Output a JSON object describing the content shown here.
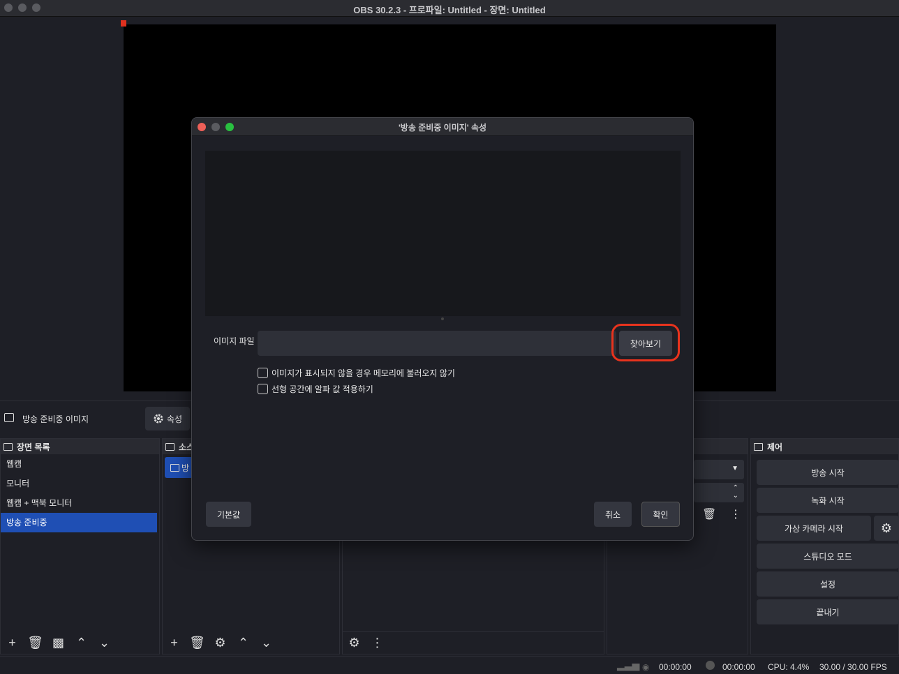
{
  "window": {
    "title": "OBS 30.2.3 - 프로파일: Untitled - 장면: Untitled"
  },
  "source_bar": {
    "source_name": "방송 준비중 이미지",
    "properties_label": "속성"
  },
  "scenes": {
    "header": "장면 목록",
    "items": [
      "웹캠",
      "모니터",
      "웹캠 + 맥북 모니터",
      "방송 준비중"
    ],
    "selected_index": 3
  },
  "sources": {
    "header": "소스",
    "first_item": "방"
  },
  "controls": {
    "header": "제어",
    "start_streaming": "방송 시작",
    "start_recording": "녹화 시작",
    "virtual_camera": "가상 카메라 시작",
    "studio_mode": "스튜디오 모드",
    "settings": "설정",
    "exit": "끝내기"
  },
  "status": {
    "stream_time": "00:00:00",
    "record_time": "00:00:00",
    "cpu": "CPU: 4.4%",
    "fps": "30.00 / 30.00 FPS"
  },
  "dialog": {
    "title": "'방송 준비중 이미지' 속성",
    "image_file_label": "이미지 파일",
    "image_file_value": "",
    "browse_label": "찾아보기",
    "unload_option": "이미지가 표시되지 않을 경우 메모리에 불러오지 않기",
    "unload_checked": false,
    "linear_alpha_option": "선형 공간에 알파 값 적용하기",
    "linear_alpha_checked": false,
    "defaults_label": "기본값",
    "cancel_label": "취소",
    "ok_label": "확인"
  },
  "colors": {
    "accent": "#1f4fb4",
    "highlight": "#e8331d",
    "close": "#ed5f57",
    "minimize": "#5a5b60",
    "zoom": "#29c040"
  }
}
